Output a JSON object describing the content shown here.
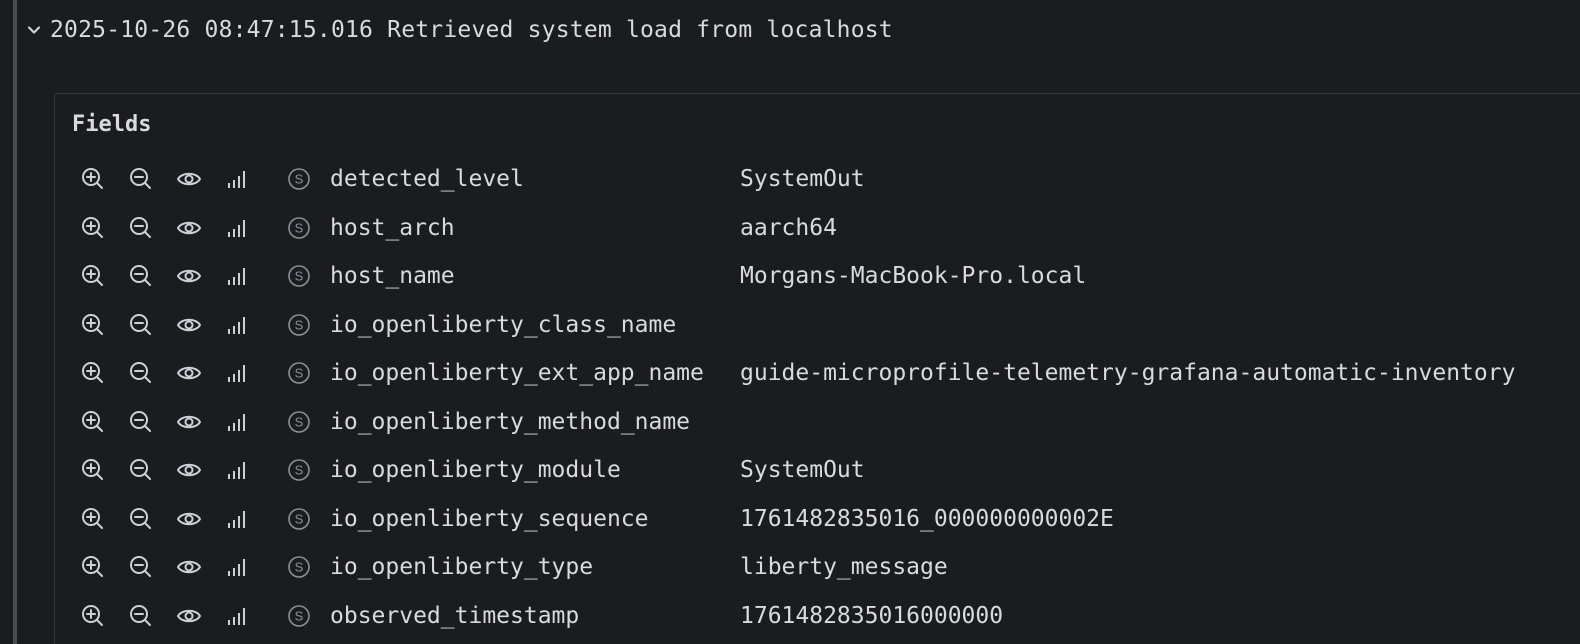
{
  "log": {
    "timestamp": "2025-10-26 08:47:15.016",
    "message": "Retrieved system load from localhost"
  },
  "fields_title": "Fields",
  "fields": [
    {
      "name": "detected_level",
      "value": "SystemOut"
    },
    {
      "name": "host_arch",
      "value": "aarch64"
    },
    {
      "name": "host_name",
      "value": "Morgans-MacBook-Pro.local"
    },
    {
      "name": "io_openliberty_class_name",
      "value": ""
    },
    {
      "name": "io_openliberty_ext_app_name",
      "value": "guide-microprofile-telemetry-grafana-automatic-inventory"
    },
    {
      "name": "io_openliberty_method_name",
      "value": ""
    },
    {
      "name": "io_openliberty_module",
      "value": "SystemOut"
    },
    {
      "name": "io_openliberty_sequence",
      "value": "1761482835016_000000000002E"
    },
    {
      "name": "io_openliberty_type",
      "value": "liberty_message"
    },
    {
      "name": "observed_timestamp",
      "value": "1761482835016000000"
    }
  ]
}
